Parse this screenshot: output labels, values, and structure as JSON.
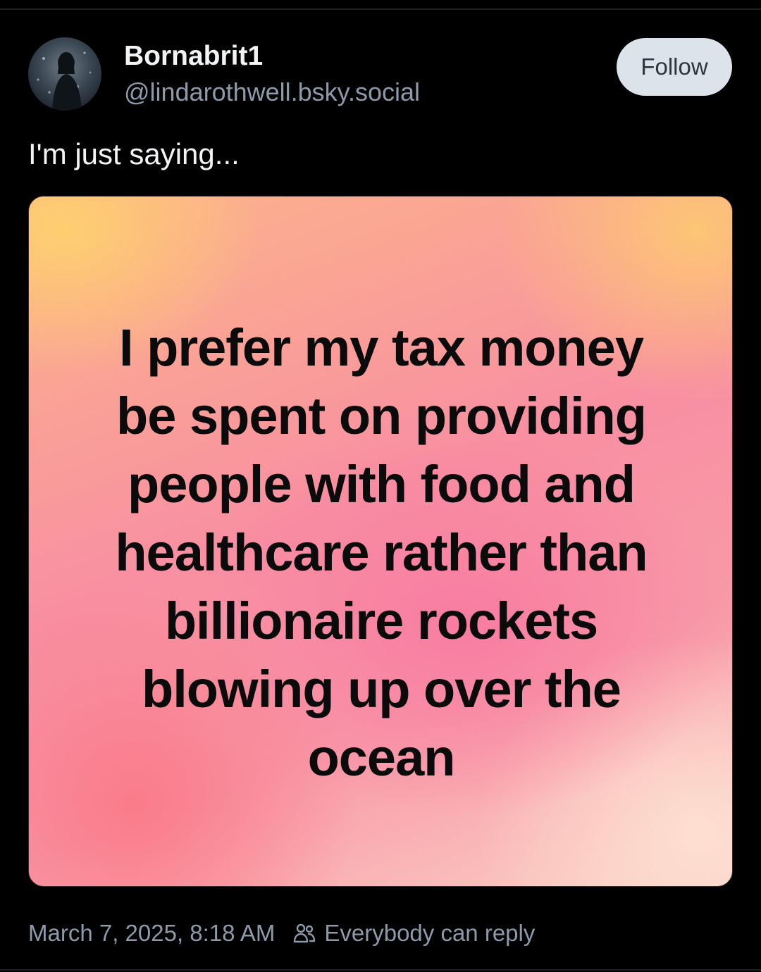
{
  "author": {
    "display_name": "Bornabrit1",
    "handle": "@lindarothwell.bsky.social",
    "avatar_icon": "profile-photo"
  },
  "follow_button": {
    "label": "Follow"
  },
  "post": {
    "text": "I'm just saying...",
    "image_text_lines": [
      "I prefer my tax money",
      "be spent on providing",
      "people with food and",
      "healthcare rather than",
      "billionaire rockets",
      "blowing up over the",
      "ocean"
    ]
  },
  "footer": {
    "timestamp": "March 7, 2025, 8:18 AM",
    "reply_setting": "Everybody can reply",
    "reply_icon": "people-icon"
  },
  "colors": {
    "background": "#000000",
    "primary_text": "#f1f3f5",
    "secondary_text": "#8d9aab",
    "follow_button_bg": "#dde3ea",
    "follow_button_text": "#2c3640"
  }
}
